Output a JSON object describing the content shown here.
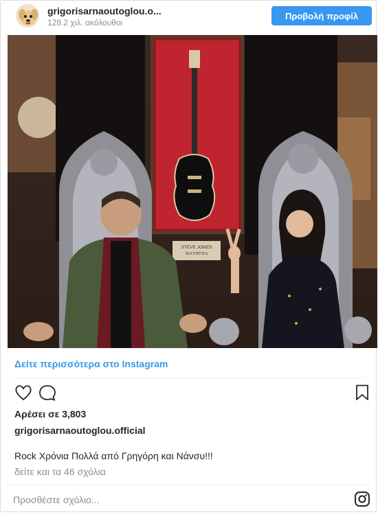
{
  "header": {
    "username": "grigorisarnaoutoglou.o...",
    "followers": "128.2 χιλ. ακόλουθοι",
    "profile_button": "Προβολή προφίλ"
  },
  "photo": {
    "plaque_line1": "STEVE JONES",
    "plaque_line2": "SEX PISTOLS"
  },
  "more_link": "Δείτε περισσότερα στο Instagram",
  "actions": {
    "like_icon": "heart-icon",
    "comment_icon": "comment-bubble-icon",
    "save_icon": "bookmark-icon"
  },
  "likes": "Αρέσει σε 3,803",
  "owner": "grigorisarnaoutoglou.official",
  "caption": "Rock Χρόνια Πολλά από Γρηγόρη και Νάνσυ!!!",
  "comments_link": "δείτε και τα 46 σχόλια",
  "comment_box": {
    "placeholder": "Προσθέστε σχόλιο...",
    "logo_icon": "instagram-logo-icon"
  },
  "colors": {
    "accent": "#3897f0",
    "muted": "#8e8e8e",
    "text": "#262626"
  }
}
